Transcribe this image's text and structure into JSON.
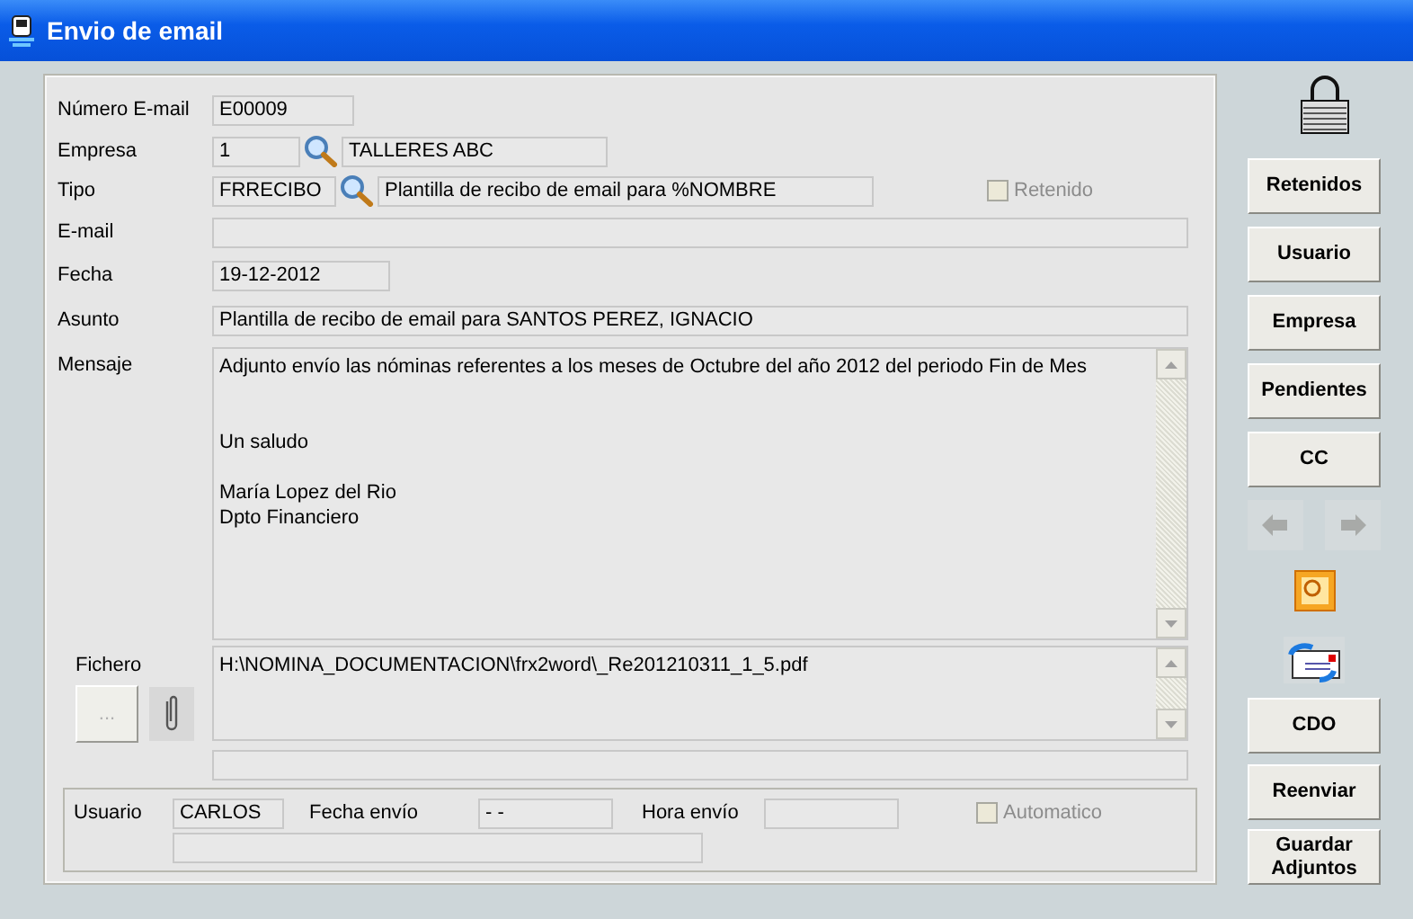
{
  "window": {
    "title": "Envio de email"
  },
  "numero_email": {
    "label": "Número E-mail",
    "value": "E00009"
  },
  "empresa": {
    "label": "Empresa",
    "code": "1",
    "name": "TALLERES ABC"
  },
  "tipo": {
    "label": "Tipo",
    "code": "FRRECIBO",
    "name": "Plantilla de recibo de email para %NOMBRE"
  },
  "retenido": {
    "label": "Retenido",
    "checked": false,
    "disabled": true
  },
  "email": {
    "label": "E-mail"
  },
  "fecha": {
    "label": "Fecha",
    "value": "19-12-2012"
  },
  "asunto": {
    "label": "Asunto",
    "value": "Plantilla de recibo de email para SANTOS PEREZ, IGNACIO"
  },
  "mensaje": {
    "label": "Mensaje",
    "value": "Adjunto envío las nóminas referentes a los meses de Octubre del año 2012 del periodo Fin de Mes\n\n\nUn saludo\n\nMaría Lopez del Rio\nDpto Financiero"
  },
  "fichero": {
    "label": "Fichero",
    "button": "...",
    "value": "H:\\NOMINA_DOCUMENTACION\\frx2word\\_Re201210311_1_5.pdf"
  },
  "usuario": {
    "label": "Usuario",
    "value": "CARLOS"
  },
  "fecha_envio": {
    "label": "Fecha envío",
    "value": "- -"
  },
  "hora_envio": {
    "label": "Hora envío"
  },
  "automatico": {
    "label": "Automatico",
    "checked": false,
    "disabled": true
  },
  "buttons_top": [
    {
      "label": "Retenidos"
    },
    {
      "label": "Usuario"
    },
    {
      "label": "Empresa"
    },
    {
      "label": "Pendientes"
    },
    {
      "label": "CC"
    }
  ],
  "buttons_bottom": [
    {
      "label": "CDO"
    },
    {
      "label": "Reenviar"
    },
    {
      "label": "Guardar Adjuntos"
    }
  ]
}
